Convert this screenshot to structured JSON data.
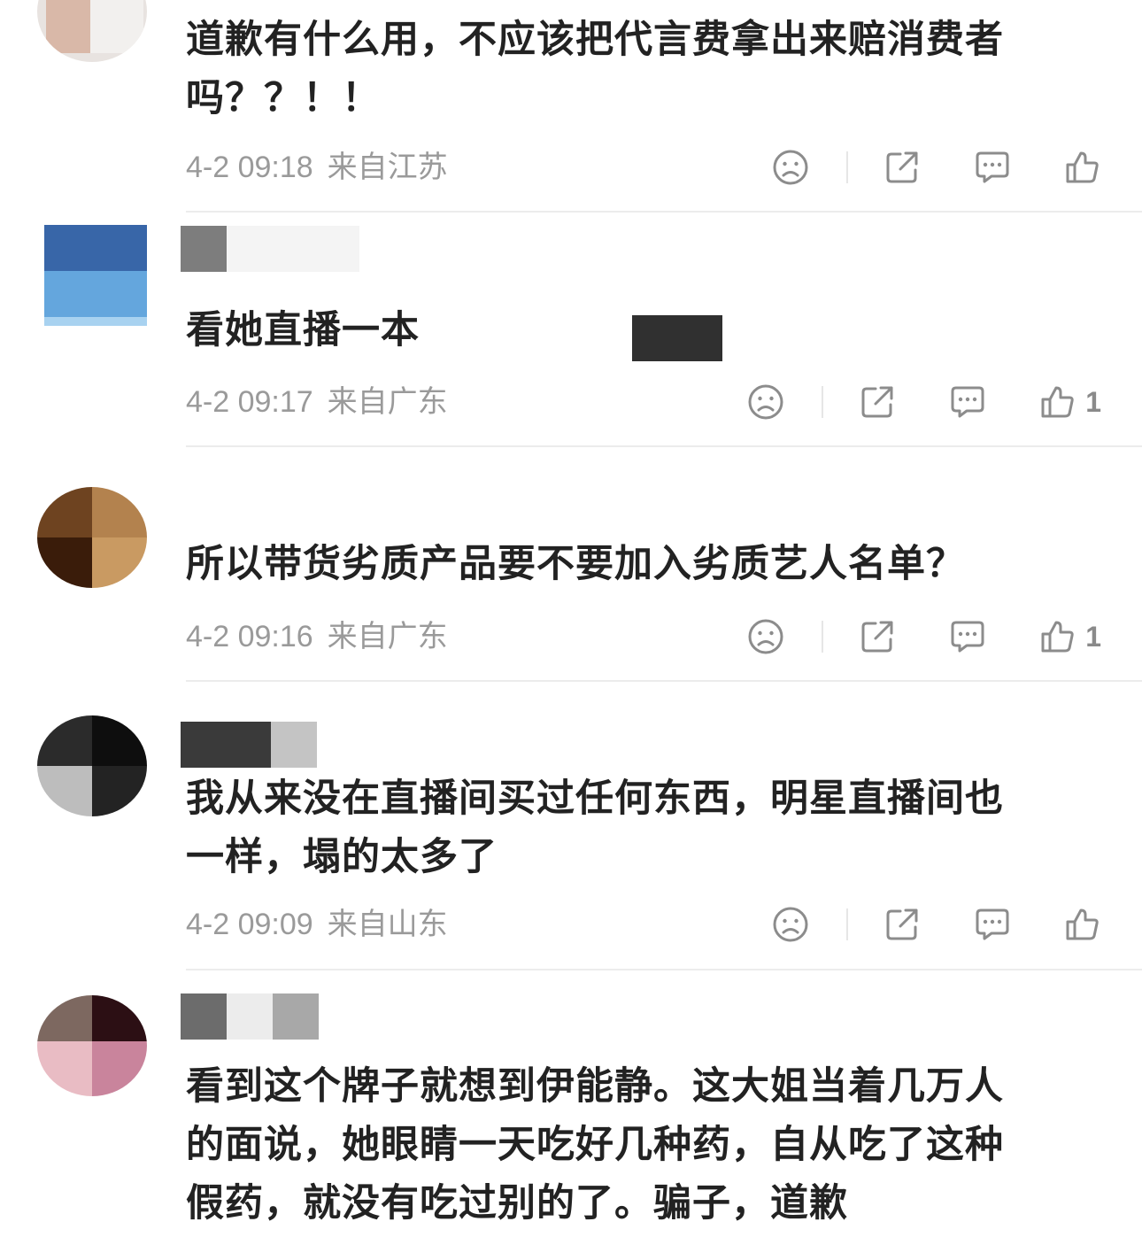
{
  "comments": [
    {
      "text_lines": [
        "道歉有什么用，不应该把代言费拿出来赔消费者",
        "吗？？！！"
      ],
      "time": "4-2 09:18",
      "location": "来自江苏",
      "likes": ""
    },
    {
      "text_lines": [
        "看她直播一本"
      ],
      "time": "4-2 09:17",
      "location": "来自广东",
      "likes": "1"
    },
    {
      "text_lines": [
        "所以带货劣质产品要不要加入劣质艺人名单？"
      ],
      "time": "4-2 09:16",
      "location": "来自广东",
      "likes": "1"
    },
    {
      "text_lines": [
        "我从来没在直播间买过任何东西，明星直播间也",
        "一样，塌的太多了"
      ],
      "time": "4-2 09:09",
      "location": "来自山东",
      "likes": ""
    },
    {
      "text_lines": [
        "看到这个牌子就想到伊能静。这大姐当着几万人",
        "的面说，她眼睛一天吃好几种药，自从吃了这种",
        "假药，就没有吃过别的了。骗子，道歉"
      ],
      "time": "",
      "location": "",
      "likes": ""
    }
  ],
  "icons": {
    "dislike": "sad-face-icon",
    "share": "share-icon",
    "reply": "comment-bubble-icon",
    "like": "thumbs-up-icon"
  },
  "colors": {
    "meta_text": "#9a9a9a",
    "icon": "#8c8c8c",
    "divider": "#ececec"
  }
}
